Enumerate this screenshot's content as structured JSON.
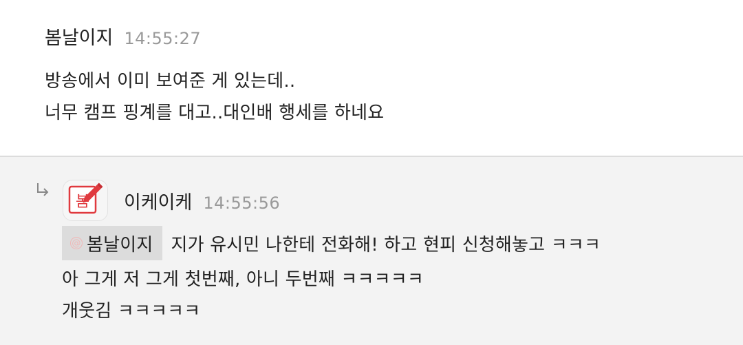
{
  "comment": {
    "author": "봄날이지",
    "time": "14:55:27",
    "lines": [
      "방송에서 이미 보여준 게 있는데..",
      "너무 캠프 핑계를 대고..대인배 행세를 하네요"
    ]
  },
  "reply": {
    "author": "이케이케",
    "time": "14:55:56",
    "avatar_icon": "bom-pencil-avatar-icon",
    "avatar_text": "봄",
    "mention": {
      "icon": "at-sign-icon",
      "symbol": "@",
      "name": "봄날이지"
    },
    "lines": [
      "지가 유시민 나한테 전화해! 하고 현피 신청해놓고 ㅋㅋㅋ",
      "아 그게 저 그게 첫번째, 아니 두번째 ㅋㅋㅋㅋㅋ",
      "개웃김 ㅋㅋㅋㅋㅋ"
    ]
  },
  "colors": {
    "accent": "#e0393e",
    "reply_background": "#f3f3f3",
    "mention_background": "#dcdcdc",
    "timestamp": "#999999"
  }
}
